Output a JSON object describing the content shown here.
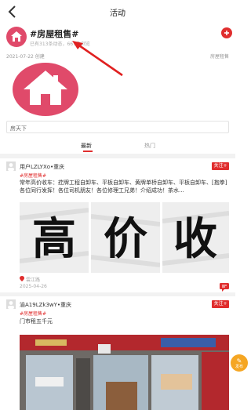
{
  "nav": {
    "title": "活动"
  },
  "topic": {
    "name": "#房屋租售#",
    "stats": "已有313条动态，667条浏览",
    "created": "2021-07-22 创建",
    "owner": "房屋租售"
  },
  "search": {
    "text": "房天下"
  },
  "tabs": {
    "latest": "最新",
    "hot": "热门"
  },
  "posts": [
    {
      "user": "用户LZLYXo•重庆",
      "follow": "关注+",
      "tag": "#房屋租售#",
      "content": "常年高价收车：荭牌工程自卸车、平板自卸车、黄牌单桥自卸车、平板自卸车、[抱拳]各位同行发挥！各位司机朋友！各位修理工兄弟！介绍成功！茶水...",
      "image_text": [
        "高",
        "价",
        "收"
      ],
      "location": "雲江路",
      "date": "2025-04-26"
    },
    {
      "user": "渝A19LZk3wY•重庆",
      "follow": "关注+",
      "tag": "#房屋租售#",
      "content": "门市租五千元"
    }
  ],
  "fab": {
    "label": "发布"
  },
  "colors": {
    "accent": "#e02e2e",
    "cover": "#e04a6a"
  }
}
